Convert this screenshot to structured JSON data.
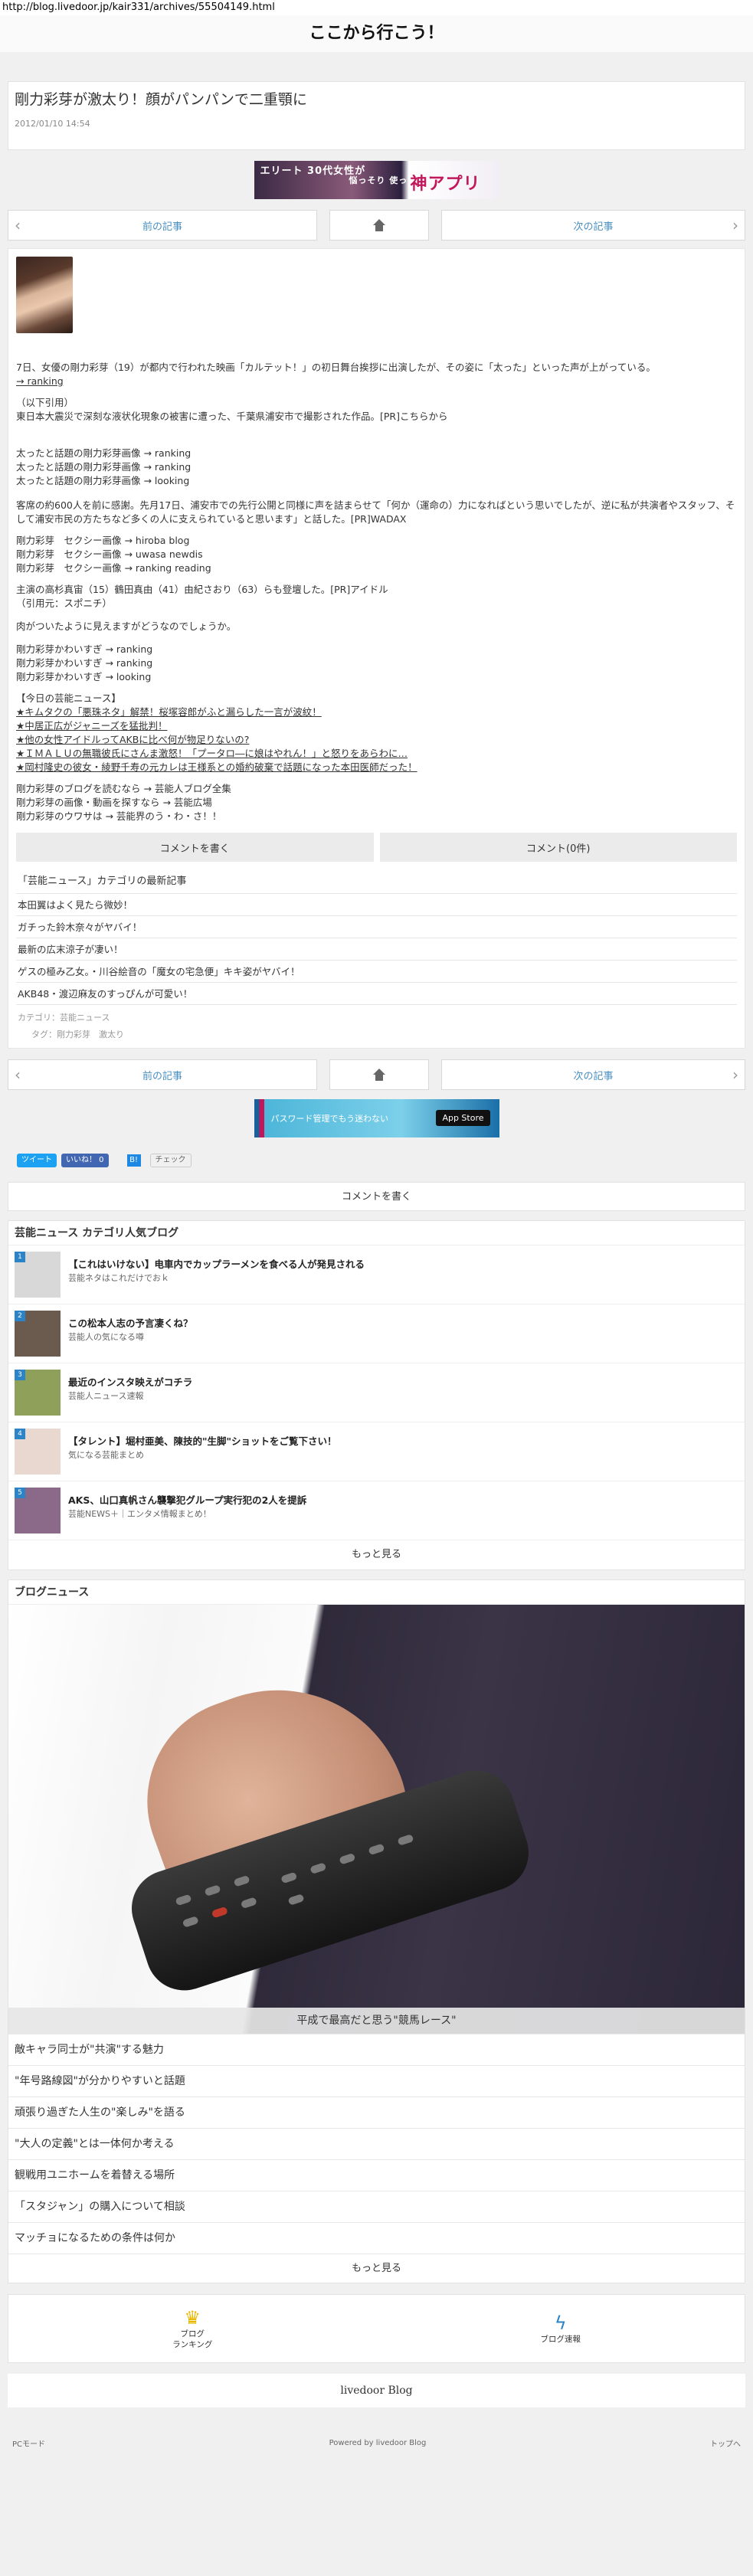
{
  "url": "http://blog.livedoor.jp/kair331/archives/55504149.html",
  "blog_title": "ここから行こう！",
  "article": {
    "title": "剛力彩芽が激太り！顔がパンパンで二重顎に",
    "date": "2012/01/10 14:54"
  },
  "ad_top": {
    "left": "エリート 30代女性が",
    "mid": "悩っそり 使ってる…",
    "right": "神アプリ"
  },
  "nav": {
    "prev": "前の記事",
    "next": "次の記事"
  },
  "body_lines": [
    "7日、女優の剛力彩芽（19）が都内で行われた映画「カルテット！」の初日舞台挨拶に出演したが、その姿に「太った」といった声が上がっている。",
    "→ ranking",
    "（以下引用）",
    "東日本大震災で深刻な液状化現象の被害に遭った、千葉県浦安市で撮影された作品。[PR]こちらから",
    "太ったと話題の剛力彩芽画像 → ranking",
    "太ったと話題の剛力彩芽画像 → ranking",
    "太ったと話題の剛力彩芽画像 → looking",
    "客席の約600人を前に感謝。先月17日、浦安市での先行公開と同様に声を詰まらせて「何か（運命の）力になればという思いでしたが、逆に私が共演者やスタッフ、そして浦安市民の方たちなど多くの人に支えられていると思います」と話した。[PR]WADAX",
    "剛力彩芽　セクシー画像 → hiroba blog",
    "剛力彩芽　セクシー画像 → uwasa newdis",
    "剛力彩芽　セクシー画像 → ranking reading",
    "主演の高杉真宙（15）鶴田真由（41）由紀さおり（63）らも登壇した。[PR]アイドル",
    "（引用元：スポニチ）",
    "肉がついたように見えますがどうなのでしょうか。",
    "剛力彩芽かわいすぎ → ranking",
    "剛力彩芽かわいすぎ → ranking",
    "剛力彩芽かわいすぎ → looking",
    "【今日の芸能ニュース】",
    "★キムタクの「悪珠ネタ」解禁！桜塚容郎がふと漏らした一言が波紋！",
    "★中居正広がジャニーズを猛批判！",
    "★他の女性アイドルってAKBに比べ何が物足りないの?",
    "★ＩＭＡＬＵの無職彼氏にさんま激怒！「プータロ―に娘はやれん！」と怒りをあらわに…",
    "★岡村隆史の彼女・綾野千寿の元カレは王様系との婚約破棄で話題になった本田医師だった！",
    "剛力彩芽のブログを読むなら → 芸能人ブログ全集",
    "剛力彩芽の画像・動画を探すなら → 芸能広場",
    "剛力彩芽のウワサは → 芸能界のう・わ・さ！！"
  ],
  "buttons": {
    "write_comment": "コメントを書く",
    "comments": "コメント(0件)"
  },
  "latest": {
    "heading": "「芸能ニュース」カテゴリの最新記事",
    "items": [
      "本田翼はよく見たら微妙！",
      "ガチった鈴木奈々がヤバイ！",
      "最新の広末涼子が凄い！",
      "ゲスの極み乙女。・川谷絵音の「魔女の宅急便」キキ姿がヤバイ！",
      "AKB48・渡辺麻友のすっぴんが可愛い！"
    ]
  },
  "meta": {
    "category": "カテゴリ：芸能ニュース",
    "tags": "タグ：剛力彩芽　激太り"
  },
  "ad_bottom": {
    "text": "パスワード管理でもう迷わない",
    "store": " App Store"
  },
  "social": {
    "tweet": "ツイート",
    "like": "いいね！ 0",
    "hatena": "B!",
    "check": "チェック"
  },
  "comment_bar": "コメントを書く",
  "popular": {
    "heading": "芸能ニュース カテゴリ人気ブログ",
    "items": [
      {
        "n": "1",
        "title": "【これはいけない】电車内でカップラーメンを食べる人が発見される",
        "sub": "芸能ネタはこれだけでおｋ",
        "color": "#d8d8d8"
      },
      {
        "n": "2",
        "title": "この松本人志の予言凄くね？",
        "sub": "芸能人の気になる噂",
        "color": "#6b5a4e"
      },
      {
        "n": "3",
        "title": "最近のインスタ映えがコチラ",
        "sub": "芸能人ニュース速報",
        "color": "#8fa05a"
      },
      {
        "n": "4",
        "title": "【タレント】堀村亜美、陳技的\"生脚\"ショットをご覧下さい！",
        "sub": "気になる芸能まとめ",
        "color": "#e9d8cf"
      },
      {
        "n": "5",
        "title": "AKS、山口真帆さん襲撃犯グループ実行犯の2人を提訴",
        "sub": "芸能NEWS＋｜エンタメ情報まとめ！",
        "color": "#8a6a88"
      }
    ],
    "more": "もっと見る"
  },
  "blog_news": {
    "heading": "ブログニュース",
    "caption": "平成で最高だと思う\"競馬レース\"",
    "items": [
      "敵キャラ同士が\"共演\"する魅力",
      "\"年号路線図\"が分かりやすいと話題",
      "頑張り過ぎた人生の\"楽しみ\"を語る",
      "\"大人の定義\"とは一体何か考える",
      "観戦用ユニホームを着替える場所",
      "「スタジャン」の購入について相談",
      "マッチョになるための条件は何か"
    ],
    "more": "もっと見る"
  },
  "footer": {
    "ranking": "ブログ\nランキング",
    "news": "ブログ速報"
  },
  "livedoor": "livedoor Blog",
  "bottom": {
    "pc": "PCモード",
    "powered": "Powered by livedoor Blog",
    "top": "トップへ"
  }
}
